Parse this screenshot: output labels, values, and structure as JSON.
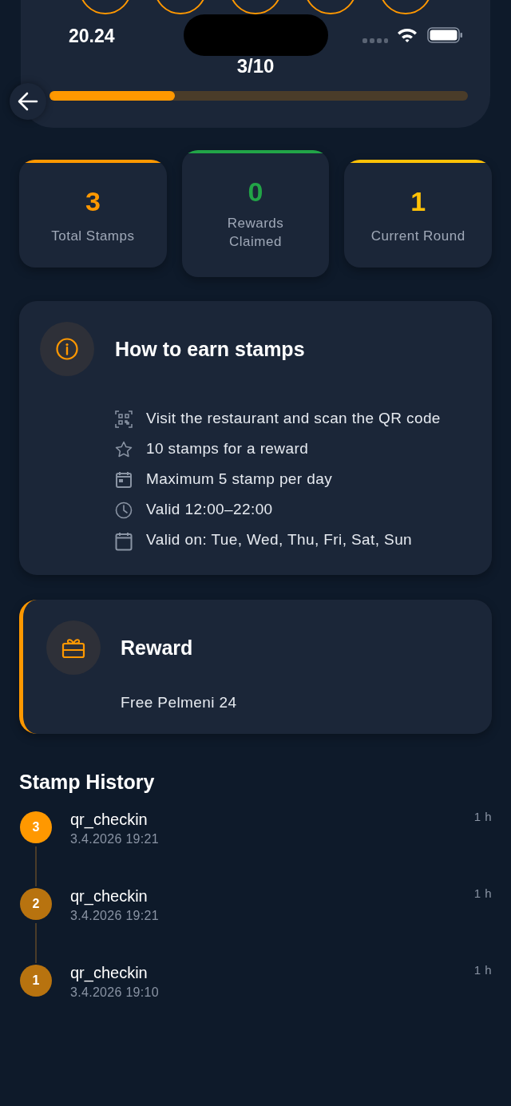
{
  "status_bar": {
    "time": "20.24"
  },
  "header": {
    "progress_text": "3/10",
    "progress": {
      "level": 0.3
    }
  },
  "stats": [
    {
      "value": "3",
      "label": "Total Stamps",
      "color": "#ff9800",
      "raised": false
    },
    {
      "value": "0",
      "label": "Rewards Claimed",
      "color": "#22a447",
      "raised": true
    },
    {
      "value": "1",
      "label": "Current Round",
      "color": "#ffc107",
      "raised": false
    }
  ],
  "how_to": {
    "title": "How to earn stamps",
    "rules": [
      {
        "kind": "qr",
        "text": "Visit the restaurant and scan the QR code"
      },
      {
        "kind": "star",
        "text": "10 stamps for a reward"
      },
      {
        "kind": "day",
        "text": "Maximum 5 stamp per day"
      },
      {
        "kind": "clock",
        "text": "Valid 12:00–22:00"
      },
      {
        "kind": "calendar",
        "text": "Valid on: Tue, Wed, Thu, Fri, Sat, Sun"
      }
    ]
  },
  "reward": {
    "title": "Reward",
    "description": "Free Pelmeni 24"
  },
  "history": {
    "title": "Stamp History",
    "items": [
      {
        "number": "3",
        "name": "qr_checkin",
        "date": "3.4.2026 19:21",
        "ago": "1 h",
        "color": "#ff9800"
      },
      {
        "number": "2",
        "name": "qr_checkin",
        "date": "3.4.2026 19:21",
        "ago": "1 h",
        "color": "#b8730f"
      },
      {
        "number": "1",
        "name": "qr_checkin",
        "date": "3.4.2026 19:10",
        "ago": "1 h",
        "color": "#b8730f"
      }
    ]
  }
}
